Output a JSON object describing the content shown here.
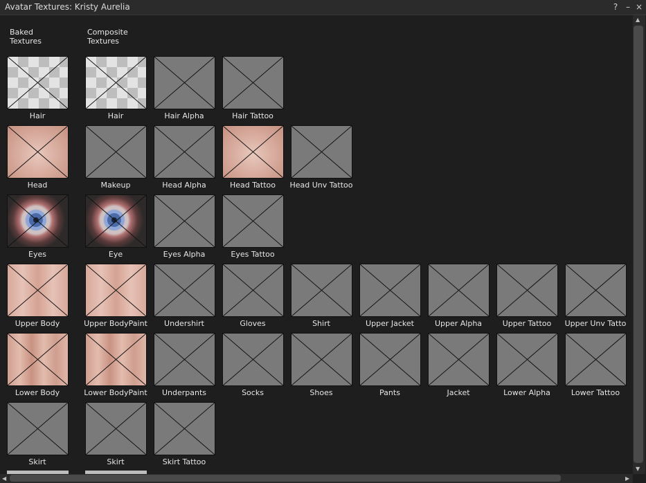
{
  "window": {
    "title": "Avatar Textures: Kristy Aurelia",
    "help_label": "?",
    "minimize_label": "–",
    "close_label": "×"
  },
  "headers": {
    "baked": [
      "Baked",
      "Textures"
    ],
    "composite": [
      "Composite",
      "Textures"
    ]
  },
  "rows": [
    [
      {
        "label": "Hair",
        "style": "checker"
      },
      {
        "label": "Hair",
        "style": "checker"
      },
      {
        "label": "Hair Alpha",
        "style": "gray"
      },
      {
        "label": "Hair Tattoo",
        "style": "gray"
      }
    ],
    [
      {
        "label": "Head",
        "style": "skin-face"
      },
      {
        "label": "Makeup",
        "style": "gray"
      },
      {
        "label": "Head Alpha",
        "style": "gray"
      },
      {
        "label": "Head Tattoo",
        "style": "skin-face"
      },
      {
        "label": "Head Unv Tattoo",
        "style": "gray"
      }
    ],
    [
      {
        "label": "Eyes",
        "style": "eyes"
      },
      {
        "label": "Eye",
        "style": "eyes"
      },
      {
        "label": "Eyes Alpha",
        "style": "gray"
      },
      {
        "label": "Eyes Tattoo",
        "style": "gray"
      }
    ],
    [
      {
        "label": "Upper Body",
        "style": "skin-body"
      },
      {
        "label": "Upper BodyPaint",
        "style": "skin-body"
      },
      {
        "label": "Undershirt",
        "style": "gray"
      },
      {
        "label": "Gloves",
        "style": "gray"
      },
      {
        "label": "Shirt",
        "style": "gray"
      },
      {
        "label": "Upper Jacket",
        "style": "gray"
      },
      {
        "label": "Upper Alpha",
        "style": "gray"
      },
      {
        "label": "Upper Tattoo",
        "style": "gray"
      },
      {
        "label": "Upper Unv Tatto",
        "style": "gray"
      }
    ],
    [
      {
        "label": "Lower Body",
        "style": "skin-legs"
      },
      {
        "label": "Lower BodyPaint",
        "style": "skin-legs"
      },
      {
        "label": "Underpants",
        "style": "gray"
      },
      {
        "label": "Socks",
        "style": "gray"
      },
      {
        "label": "Shoes",
        "style": "gray"
      },
      {
        "label": "Pants",
        "style": "gray"
      },
      {
        "label": "Jacket",
        "style": "gray"
      },
      {
        "label": "Lower Alpha",
        "style": "gray"
      },
      {
        "label": "Lower Tattoo",
        "style": "gray"
      }
    ],
    [
      {
        "label": "Skirt",
        "style": "gray"
      },
      {
        "label": "Skirt",
        "style": "gray"
      },
      {
        "label": "Skirt Tattoo",
        "style": "gray"
      }
    ]
  ]
}
